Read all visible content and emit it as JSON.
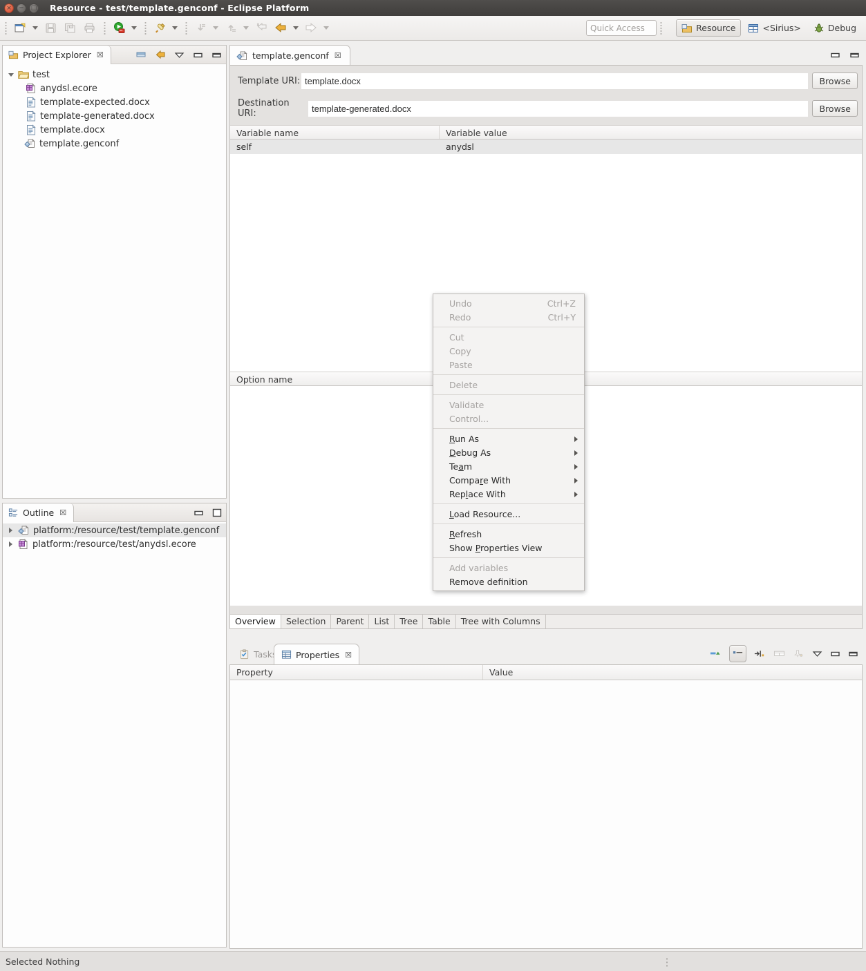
{
  "window": {
    "title": "Resource - test/template.genconf - Eclipse Platform",
    "buttons": {
      "close": "close",
      "minimize": "minimize",
      "maximize": "maximize"
    }
  },
  "toolbar": {
    "items": [
      {
        "name": "new-wizard",
        "icon": "new-file-icon"
      },
      {
        "name": "new-dropdown",
        "icon": "chevron-down-icon"
      },
      {
        "name": "save",
        "icon": "save-icon"
      },
      {
        "name": "save-all",
        "icon": "save-all-icon"
      },
      {
        "name": "print",
        "icon": "print-icon"
      },
      {
        "name": "run",
        "icon": "run-icon"
      },
      {
        "name": "run-dropdown",
        "icon": "chevron-down-icon"
      },
      {
        "name": "external-tools",
        "icon": "external-tools-icon"
      },
      {
        "name": "external-tools-dropdown",
        "icon": "chevron-down-icon"
      },
      {
        "name": "previous-annotation",
        "icon": "previous-annotation-icon"
      },
      {
        "name": "previous-annotation-dropdown",
        "icon": "chevron-down-icon"
      },
      {
        "name": "next-annotation",
        "icon": "next-annotation-icon"
      },
      {
        "name": "next-annotation-dropdown",
        "icon": "chevron-down-icon"
      },
      {
        "name": "last-edit-location",
        "icon": "last-edit-location-icon"
      },
      {
        "name": "back",
        "icon": "arrow-left-icon"
      },
      {
        "name": "back-dropdown",
        "icon": "chevron-down-icon"
      },
      {
        "name": "forward",
        "icon": "arrow-right-icon"
      },
      {
        "name": "forward-dropdown",
        "icon": "chevron-down-icon"
      }
    ],
    "quick_access_placeholder": "Quick Access",
    "open_perspective_icon": "open-perspective-icon",
    "perspectives": [
      {
        "label": "Resource",
        "icon": "resource-perspective-icon",
        "active": true
      },
      {
        "label": "<Sirius>",
        "icon": "sirius-perspective-icon",
        "active": false
      },
      {
        "label": "Debug",
        "icon": "debug-perspective-icon",
        "active": false
      }
    ]
  },
  "project_explorer": {
    "title": "Project Explorer",
    "icon": "project-explorer-icon",
    "close_glyph": "☒",
    "tools": [
      {
        "name": "collapse-all",
        "icon": "collapse-all-icon"
      },
      {
        "name": "link-with-editor",
        "icon": "link-with-editor-icon"
      },
      {
        "name": "view-menu",
        "icon": "view-menu-icon"
      },
      {
        "name": "minimize",
        "icon": "minimize-icon"
      },
      {
        "name": "maximize",
        "icon": "maximize-icon"
      }
    ],
    "tree": [
      {
        "label": "test",
        "icon": "folder-icon",
        "twisty": "down",
        "indent": 0
      },
      {
        "label": "anydsl.ecore",
        "icon": "ecore-icon",
        "twisty": "none",
        "indent": 1
      },
      {
        "label": "template-expected.docx",
        "icon": "docx-icon",
        "twisty": "none",
        "indent": 1
      },
      {
        "label": "template-generated.docx",
        "icon": "docx-icon",
        "twisty": "none",
        "indent": 1
      },
      {
        "label": "template.docx",
        "icon": "docx-icon",
        "twisty": "none",
        "indent": 1
      },
      {
        "label": "template.genconf",
        "icon": "genconf-icon",
        "twisty": "none",
        "indent": 1
      }
    ]
  },
  "outline": {
    "title": "Outline",
    "icon": "outline-icon",
    "close_glyph": "☒",
    "tools": [
      {
        "name": "minimize",
        "icon": "minimize-icon"
      },
      {
        "name": "restore",
        "icon": "restore-icon"
      }
    ],
    "tree": [
      {
        "label": "platform:/resource/test/template.genconf",
        "icon": "genconf-icon",
        "twisty": "right",
        "selected": true
      },
      {
        "label": "platform:/resource/test/anydsl.ecore",
        "icon": "ecore-icon",
        "twisty": "right",
        "selected": false
      }
    ]
  },
  "editor": {
    "tab": {
      "label": "template.genconf",
      "icon": "genconf-icon",
      "close_glyph": "☒"
    },
    "tools": [
      {
        "name": "minimize",
        "icon": "minimize-icon"
      },
      {
        "name": "maximize",
        "icon": "maximize-icon"
      }
    ],
    "template_uri": {
      "label": "Template URI:",
      "value": "template.docx",
      "browse": "Browse"
    },
    "destination_uri": {
      "label": "Destination URI:",
      "value": "template-generated.docx",
      "browse": "Browse"
    },
    "variables_table": {
      "columns": [
        "Variable name",
        "Variable value"
      ],
      "rows": [
        [
          "self",
          "anydsl"
        ]
      ]
    },
    "options_table": {
      "columns": [
        "Option name"
      ],
      "rows": []
    },
    "bottom_tabs": [
      {
        "label": "Overview",
        "active": true
      },
      {
        "label": "Selection",
        "active": false
      },
      {
        "label": "Parent",
        "active": false
      },
      {
        "label": "List",
        "active": false
      },
      {
        "label": "Tree",
        "active": false
      },
      {
        "label": "Table",
        "active": false
      },
      {
        "label": "Tree with Columns",
        "active": false
      }
    ]
  },
  "bottom_view": {
    "tabs": [
      {
        "label": "Tasks",
        "icon": "tasks-icon",
        "active": false
      },
      {
        "label": "Properties",
        "icon": "properties-icon",
        "active": true,
        "close_glyph": "☒"
      }
    ],
    "tools": [
      {
        "name": "show-advanced-properties",
        "icon": "advanced-properties-icon",
        "pressed": false
      },
      {
        "name": "show-categories",
        "icon": "show-categories-icon",
        "pressed": true
      },
      {
        "name": "restore-default-value",
        "icon": "restore-default-icon",
        "pressed": false
      },
      {
        "name": "show-columns",
        "icon": "show-columns-icon",
        "pressed": false
      },
      {
        "name": "pin-properties",
        "icon": "pin-icon",
        "pressed": false
      },
      {
        "name": "view-menu",
        "icon": "view-menu-icon",
        "pressed": false
      },
      {
        "name": "minimize",
        "icon": "minimize-icon",
        "pressed": false
      },
      {
        "name": "maximize",
        "icon": "maximize-icon",
        "pressed": false
      }
    ],
    "table": {
      "columns": [
        "Property",
        "Value"
      ],
      "rows": []
    }
  },
  "context_menu": {
    "items": [
      {
        "label": "Undo",
        "accel": "Ctrl+Z",
        "disabled": true,
        "submenu": false,
        "mnemonic": -1
      },
      {
        "label": "Redo",
        "accel": "Ctrl+Y",
        "disabled": true,
        "submenu": false,
        "mnemonic": -1
      },
      {
        "separator": true
      },
      {
        "label": "Cut",
        "accel": "",
        "disabled": true,
        "submenu": false,
        "mnemonic": -1
      },
      {
        "label": "Copy",
        "accel": "",
        "disabled": true,
        "submenu": false,
        "mnemonic": -1
      },
      {
        "label": "Paste",
        "accel": "",
        "disabled": true,
        "submenu": false,
        "mnemonic": -1
      },
      {
        "separator": true
      },
      {
        "label": "Delete",
        "accel": "",
        "disabled": true,
        "submenu": false,
        "mnemonic": -1
      },
      {
        "separator": true
      },
      {
        "label": "Validate",
        "accel": "",
        "disabled": true,
        "submenu": false,
        "mnemonic": -1
      },
      {
        "label": "Control...",
        "accel": "",
        "disabled": true,
        "submenu": false,
        "mnemonic": -1
      },
      {
        "separator": true
      },
      {
        "label": "Run As",
        "accel": "",
        "disabled": false,
        "submenu": true,
        "mnemonic": 0
      },
      {
        "label": "Debug As",
        "accel": "",
        "disabled": false,
        "submenu": true,
        "mnemonic": 0
      },
      {
        "label": "Team",
        "accel": "",
        "disabled": false,
        "submenu": true,
        "mnemonic": 2
      },
      {
        "label": "Compare With",
        "accel": "",
        "disabled": false,
        "submenu": true,
        "mnemonic": 5
      },
      {
        "label": "Replace With",
        "accel": "",
        "disabled": false,
        "submenu": true,
        "mnemonic": 3
      },
      {
        "separator": true
      },
      {
        "label": "Load Resource...",
        "accel": "",
        "disabled": false,
        "submenu": false,
        "mnemonic": 0
      },
      {
        "separator": true
      },
      {
        "label": "Refresh",
        "accel": "",
        "disabled": false,
        "submenu": false,
        "mnemonic": 0
      },
      {
        "label": "Show Properties View",
        "accel": "",
        "disabled": false,
        "submenu": false,
        "mnemonic": 5
      },
      {
        "separator": true
      },
      {
        "label": "Add variables",
        "accel": "",
        "disabled": true,
        "submenu": false,
        "mnemonic": -1
      },
      {
        "label": "Remove definition",
        "accel": "",
        "disabled": false,
        "submenu": false,
        "mnemonic": -1
      }
    ]
  },
  "status_bar": {
    "text": "Selected Nothing"
  },
  "colors": {
    "titlebar": "#46443f",
    "toolbar": "#efedeb",
    "panel_bg": "#fdfdfd",
    "editor_bg": "#e4e2e0",
    "selection": "#e7e7e7",
    "accent_orange": "#e8a33d",
    "border": "#c2bfbc"
  }
}
